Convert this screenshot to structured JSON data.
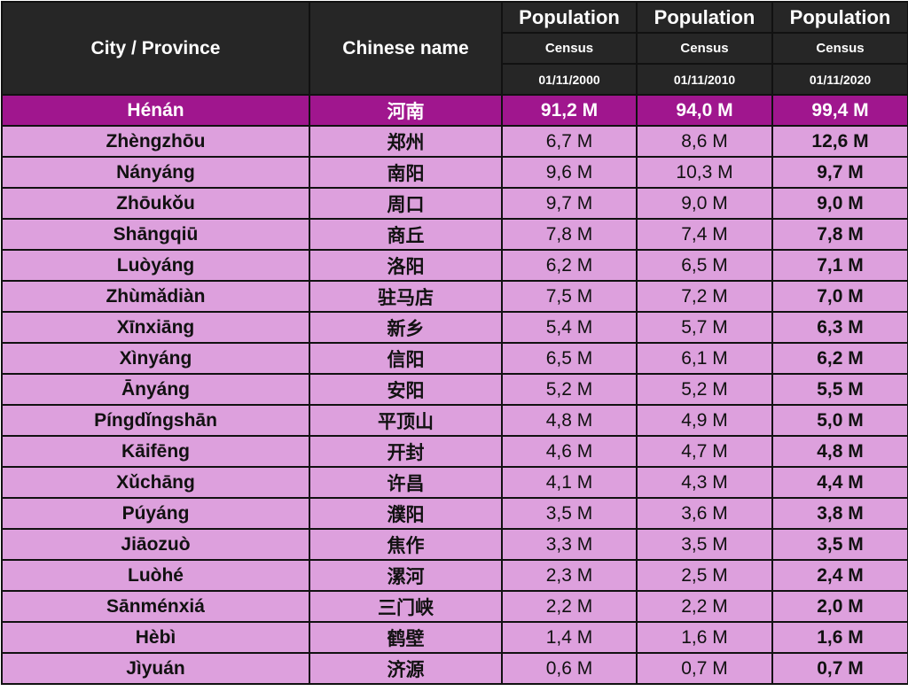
{
  "header": {
    "col_city": "City / Province",
    "col_chinese": "Chinese name",
    "population_label": "Population",
    "census_label": "Census",
    "dates": [
      "01/11/2000",
      "01/11/2010",
      "01/11/2020"
    ]
  },
  "province": {
    "name": "Hénán",
    "chinese": "河南",
    "p2000": "91,2 M",
    "p2010": "94,0 M",
    "p2020": "99,4 M"
  },
  "cities": [
    {
      "name": "Zhèngzhōu",
      "chinese": "郑州",
      "p2000": "6,7 M",
      "p2010": "8,6 M",
      "p2020": "12,6 M"
    },
    {
      "name": "Nányáng",
      "chinese": "南阳",
      "p2000": "9,6 M",
      "p2010": "10,3 M",
      "p2020": "9,7 M"
    },
    {
      "name": "Zhōukǒu",
      "chinese": "周口",
      "p2000": "9,7 M",
      "p2010": "9,0 M",
      "p2020": "9,0 M"
    },
    {
      "name": "Shāngqiū",
      "chinese": "商丘",
      "p2000": "7,8 M",
      "p2010": "7,4 M",
      "p2020": "7,8 M"
    },
    {
      "name": "Luòyáng",
      "chinese": "洛阳",
      "p2000": "6,2 M",
      "p2010": "6,5 M",
      "p2020": "7,1 M"
    },
    {
      "name": "Zhùmǎdiàn",
      "chinese": "驻马店",
      "p2000": "7,5 M",
      "p2010": "7,2 M",
      "p2020": "7,0 M"
    },
    {
      "name": "Xīnxiāng",
      "chinese": "新乡",
      "p2000": "5,4 M",
      "p2010": "5,7 M",
      "p2020": "6,3 M"
    },
    {
      "name": "Xìnyáng",
      "chinese": "信阳",
      "p2000": "6,5 M",
      "p2010": "6,1 M",
      "p2020": "6,2 M"
    },
    {
      "name": "Ānyáng",
      "chinese": "安阳",
      "p2000": "5,2 M",
      "p2010": "5,2 M",
      "p2020": "5,5 M"
    },
    {
      "name": "Píngdǐngshān",
      "chinese": "平顶山",
      "p2000": "4,8 M",
      "p2010": "4,9 M",
      "p2020": "5,0 M"
    },
    {
      "name": "Kāifēng",
      "chinese": "开封",
      "p2000": "4,6 M",
      "p2010": "4,7 M",
      "p2020": "4,8 M"
    },
    {
      "name": "Xǔchāng",
      "chinese": "许昌",
      "p2000": "4,1 M",
      "p2010": "4,3 M",
      "p2020": "4,4 M"
    },
    {
      "name": "Púyáng",
      "chinese": "濮阳",
      "p2000": "3,5 M",
      "p2010": "3,6 M",
      "p2020": "3,8 M"
    },
    {
      "name": "Jiāozuò",
      "chinese": "焦作",
      "p2000": "3,3 M",
      "p2010": "3,5 M",
      "p2020": "3,5 M"
    },
    {
      "name": "Luòhé",
      "chinese": "漯河",
      "p2000": "2,3 M",
      "p2010": "2,5 M",
      "p2020": "2,4 M"
    },
    {
      "name": "Sānménxiá",
      "chinese": "三门峡",
      "p2000": "2,2 M",
      "p2010": "2,2 M",
      "p2020": "2,0 M"
    },
    {
      "name": "Hèbì",
      "chinese": "鹤壁",
      "p2000": "1,4 M",
      "p2010": "1,6 M",
      "p2020": "1,6 M"
    },
    {
      "name": "Jìyuán",
      "chinese": "济源",
      "p2000": "0,6 M",
      "p2010": "0,7 M",
      "p2020": "0,7 M"
    }
  ],
  "colors": {
    "header_bg": "#262626",
    "province_bg": "#a0168e",
    "city_bg": "#dda0dd",
    "border": "#111111"
  }
}
